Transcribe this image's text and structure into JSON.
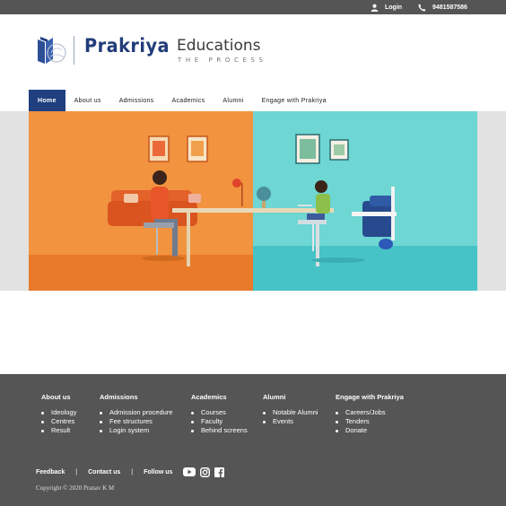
{
  "topbar": {
    "login_label": "Login",
    "phone": "9481587586",
    "icons": [
      "user-icon",
      "phone-icon"
    ]
  },
  "logo": {
    "brand": "Prakriya",
    "name": "Educations",
    "tagline": "THE PROCESS"
  },
  "nav": {
    "items": [
      "Home",
      "About us",
      "Admissions",
      "Academics",
      "Alumni",
      "Engage with Prakriya"
    ],
    "active": "Home"
  },
  "colors": {
    "topbar": "#555555",
    "nav_active": "#1f3f7f",
    "brand_blue": "#223d7a",
    "hero_left": "#f08a3a",
    "hero_right": "#6fd4d0",
    "footer": "#555555"
  },
  "footer": {
    "columns": [
      {
        "title": "About us",
        "items": [
          "Ideology",
          "Centres",
          "Result"
        ]
      },
      {
        "title": "Admissions",
        "items": [
          "Admission procedure",
          "Fee structures",
          "Login system"
        ]
      },
      {
        "title": "Academics",
        "items": [
          "Courses",
          "Faculty",
          "Behind screens"
        ]
      },
      {
        "title": "Alumni",
        "items": [
          "Notable Alumni",
          "Events"
        ]
      },
      {
        "title": "Engage with Prakriya",
        "items": [
          "Careers/Jobs",
          "Tenders",
          "Donate"
        ]
      }
    ],
    "links": {
      "feedback": "Feedback",
      "separator": "|",
      "contact": "Contact us",
      "follow": "Follow us"
    },
    "social_icons": [
      "youtube-icon",
      "instagram-icon",
      "facebook-icon"
    ],
    "copyright": "Copyright © 2020 Pranav K M"
  }
}
